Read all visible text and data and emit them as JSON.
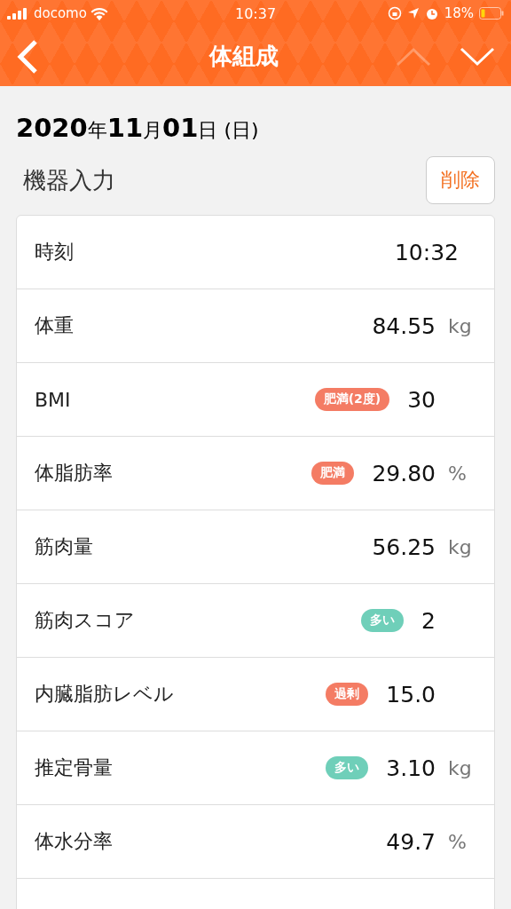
{
  "status_bar": {
    "carrier": "docomo",
    "time": "10:37",
    "battery": "18%"
  },
  "nav": {
    "title": "体組成",
    "prev_disabled": true,
    "next_disabled": false
  },
  "date": "**2020**年**11**月**01**日 (日)",
  "section": {
    "title": "機器入力",
    "delete_button": "削除"
  },
  "rows": [
    {
      "kind": "time",
      "label": "時刻",
      "value": "10:32"
    },
    {
      "kind": "measure",
      "label": "体重",
      "value": "84.55",
      "unit": "kg"
    },
    {
      "kind": "measure",
      "label": "BMI",
      "value": "30",
      "badge": {
        "text": "肥満(2度)",
        "color": "#f47c64"
      }
    },
    {
      "kind": "measure",
      "label": "体脂肪率",
      "value": "29.80",
      "unit": "%",
      "badge": {
        "text": "肥満",
        "color": "#f47c64"
      }
    },
    {
      "kind": "measure",
      "label": "筋肉量",
      "value": "56.25",
      "unit": "kg"
    },
    {
      "kind": "measure",
      "label": "筋肉スコア",
      "value": "2",
      "badge": {
        "text": "多い",
        "color": "#6fcfb9"
      }
    },
    {
      "kind": "measure",
      "label": "内臓脂肪レベル",
      "value": "15.0",
      "badge": {
        "text": "過剰",
        "color": "#f47c64"
      }
    },
    {
      "kind": "measure",
      "label": "推定骨量",
      "value": "3.10",
      "unit": "kg",
      "badge": {
        "text": "多い",
        "color": "#6fcfb9"
      }
    },
    {
      "kind": "measure",
      "label": "体水分率",
      "value": "49.7",
      "unit": "%"
    },
    {
      "kind": "empty"
    }
  ]
}
